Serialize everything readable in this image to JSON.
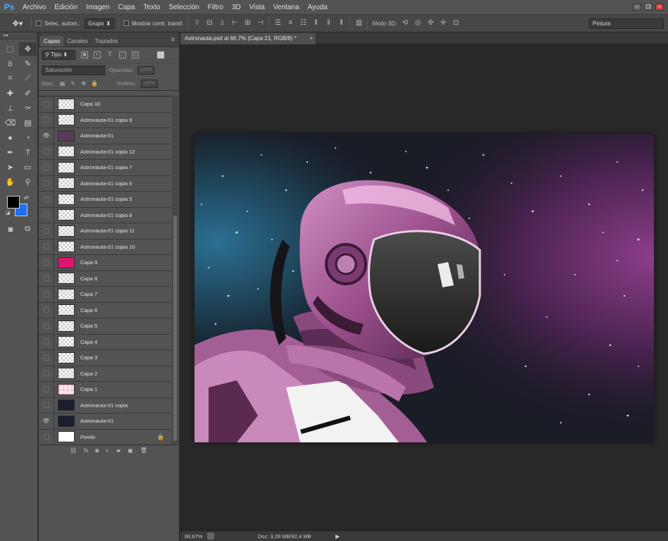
{
  "app": {
    "logo": "Ps"
  },
  "menu": [
    "Archivo",
    "Edición",
    "Imagen",
    "Capa",
    "Texto",
    "Selección",
    "Filtro",
    "3D",
    "Vista",
    "Ventana",
    "Ayuda"
  ],
  "options": {
    "auto_select_label": "Selec. autom.:",
    "auto_select_value": "Grupo",
    "transform_label": "Mostrar contr. transf.",
    "mode3d_label": "Modo 3D:",
    "workspace": "Pintura"
  },
  "layers_panel": {
    "tabs": [
      "Capas",
      "Canales",
      "Trazados"
    ],
    "filter": "Tipo",
    "blend_mode": "Saturación",
    "opacity_label": "Opacidad:",
    "opacity_value": "100%",
    "lock_label": "Bloq.:",
    "fill_label": "Relleno:",
    "fill_value": "100%",
    "layers": [
      {
        "name": "Capa 10",
        "visible": false,
        "thumb": "transparent"
      },
      {
        "name": "Astronauta-01 copia 9",
        "visible": false,
        "thumb": "transparent"
      },
      {
        "name": "Astronauta-01",
        "visible": true,
        "thumb": "astro"
      },
      {
        "name": "Astronauta-01 copia 12",
        "visible": false,
        "thumb": "transparent"
      },
      {
        "name": "Astronauta-01 copia 7",
        "visible": false,
        "thumb": "transparent"
      },
      {
        "name": "Astronauta-01 copia 6",
        "visible": false,
        "thumb": "transparent"
      },
      {
        "name": "Astronauta-01 copia 5",
        "visible": false,
        "thumb": "transparent"
      },
      {
        "name": "Astronauta-01 copia 8",
        "visible": false,
        "thumb": "transparent"
      },
      {
        "name": "Astronauta-01 copia 11",
        "visible": false,
        "thumb": "transparent"
      },
      {
        "name": "Astronauta-01 copia 10",
        "visible": false,
        "thumb": "transparent"
      },
      {
        "name": "Capa 9",
        "visible": false,
        "thumb": "pink"
      },
      {
        "name": "Capa 8",
        "visible": false,
        "thumb": "transparent"
      },
      {
        "name": "Capa 7",
        "visible": false,
        "thumb": "transparent"
      },
      {
        "name": "Capa 6",
        "visible": false,
        "thumb": "transparent"
      },
      {
        "name": "Capa 5",
        "visible": false,
        "thumb": "transparent"
      },
      {
        "name": "Capa 4",
        "visible": false,
        "thumb": "transparent"
      },
      {
        "name": "Capa 3",
        "visible": false,
        "thumb": "transparent"
      },
      {
        "name": "Capa 2",
        "visible": false,
        "thumb": "transparent"
      },
      {
        "name": "Capa 1",
        "visible": false,
        "thumb": "pinkish"
      },
      {
        "name": "Astronauta-01 copia",
        "visible": false,
        "thumb": "dark"
      },
      {
        "name": "Astronauta-01",
        "visible": true,
        "thumb": "dark"
      },
      {
        "name": "Fondo",
        "visible": false,
        "thumb": "white",
        "italic": true,
        "locked": true
      }
    ]
  },
  "document": {
    "tab_title": "Astronauta.psd al 66,7% (Capa 21, RGB/8) *",
    "close": "×"
  },
  "status": {
    "zoom": "66,67%",
    "doc_info": "Doc: 3,28 MB/92,4 MB",
    "arrow": "▶"
  },
  "colors": {
    "foreground": "#000000",
    "background": "#1e6ff2",
    "accent_pink": "#c06aa8"
  }
}
